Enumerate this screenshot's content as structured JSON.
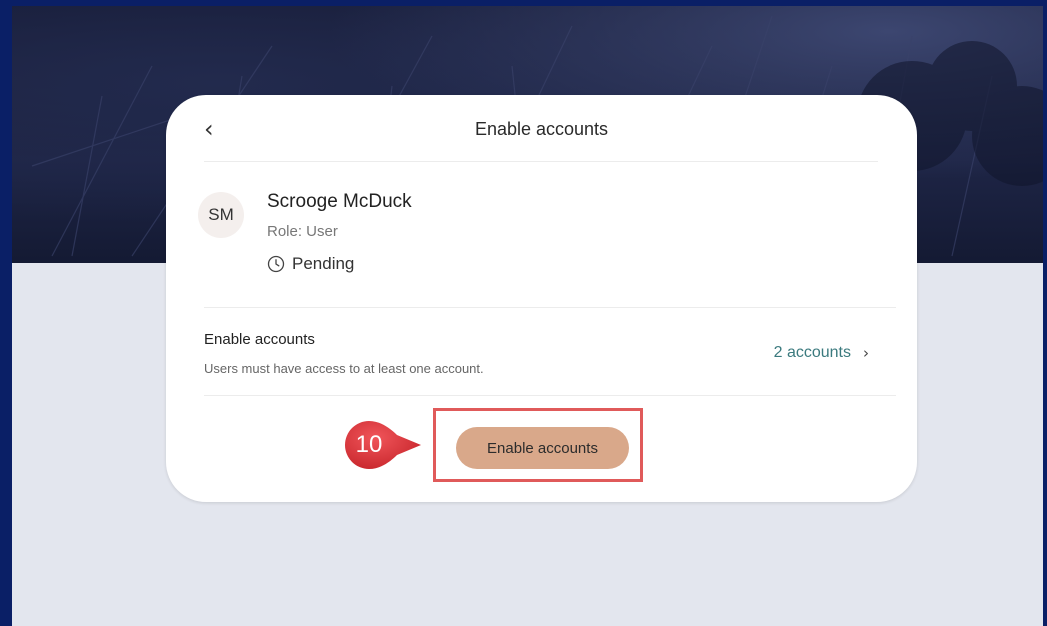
{
  "dialog": {
    "title": "Enable accounts",
    "back_icon": "chevron-left-icon"
  },
  "user": {
    "initials": "SM",
    "name": "Scrooge McDuck",
    "role": "Role: User",
    "status": "Pending",
    "status_icon": "clock-icon"
  },
  "section": {
    "title": "Enable accounts",
    "description": "Users must have access to at least one account.",
    "accounts_link": "2 accounts",
    "accounts_chevron": "›"
  },
  "actions": {
    "primary_label": "Enable accounts"
  },
  "annotation": {
    "step_number": "10",
    "highlight_color": "#e05a5a",
    "badge_color": "#e0383c"
  },
  "colors": {
    "outer_border": "#0a1f66",
    "page_bg": "#e3e6ee",
    "button_bg": "#d9a88a",
    "link": "#3b7a7e"
  }
}
